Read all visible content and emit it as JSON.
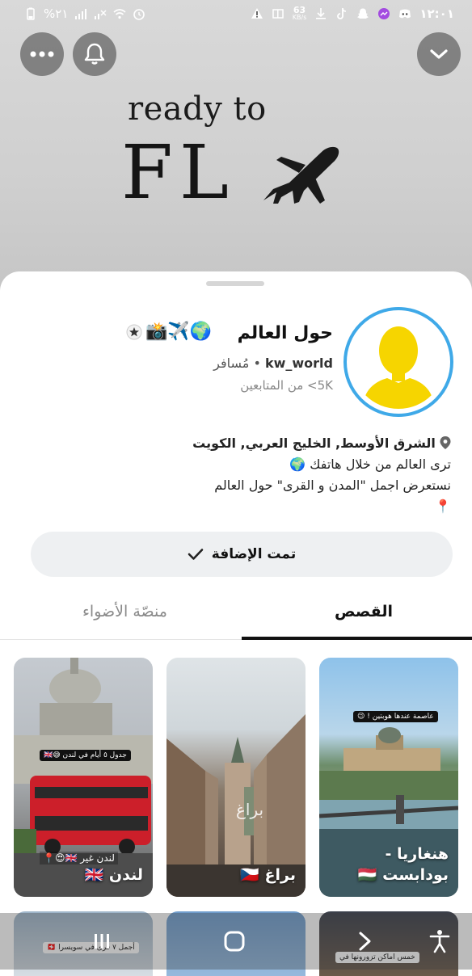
{
  "status_bar": {
    "time": "١٢:٠١",
    "battery": "%٢١",
    "net_speed_value": "63",
    "net_speed_unit": "KB/s"
  },
  "banner": {
    "line1": "ready to",
    "line2": "FL"
  },
  "profile": {
    "name": "حول العالم",
    "name_emojis": "📸✈️🌍",
    "username": "kw_world",
    "category": "مُسافر",
    "separator": "•",
    "followers": "5K> من المتابعين",
    "avatar_ring_color": "#3fa9e8",
    "avatar_color": "#f6d500"
  },
  "bio": {
    "location": "الشرق الأوسط, الخليج العربي, الكويت",
    "line1": "ترى العالم من خلال هاتفك 🌍",
    "line2": "نستعرض اجمل \"المدن و القرى\" حول العالم",
    "line3": "📍"
  },
  "added_button": {
    "label": "تمت الإضافة"
  },
  "tabs": [
    {
      "label": "القصص",
      "active": true
    },
    {
      "label": "منصّة الأضواء",
      "active": false
    }
  ],
  "stories": [
    {
      "title_line1": "هنغاريا -",
      "title_line2": "بودابست 🇭🇺",
      "sticker": "عاصمة عندها هوبتين ! 😉"
    },
    {
      "title_line1": "براغ 🇨🇿",
      "title_line2": "",
      "overlay": "براغ"
    },
    {
      "title_line1": "لندن 🇬🇧",
      "title_line2": "",
      "sticker": "جدول ٥ أيام في لندن 😅🇬🇧",
      "overlay": "لندن غير 🇬🇧😍📍"
    }
  ],
  "stories_row2": [
    {
      "sticker": "خمس اماكن تزورونها في"
    },
    {
      "sticker": ""
    },
    {
      "sticker": "أجمل ٧ قرى في سويسرا 🇨🇭"
    }
  ],
  "colors": {
    "accent_ring": "#3fa9e8",
    "button_bg": "#eef0f2"
  }
}
